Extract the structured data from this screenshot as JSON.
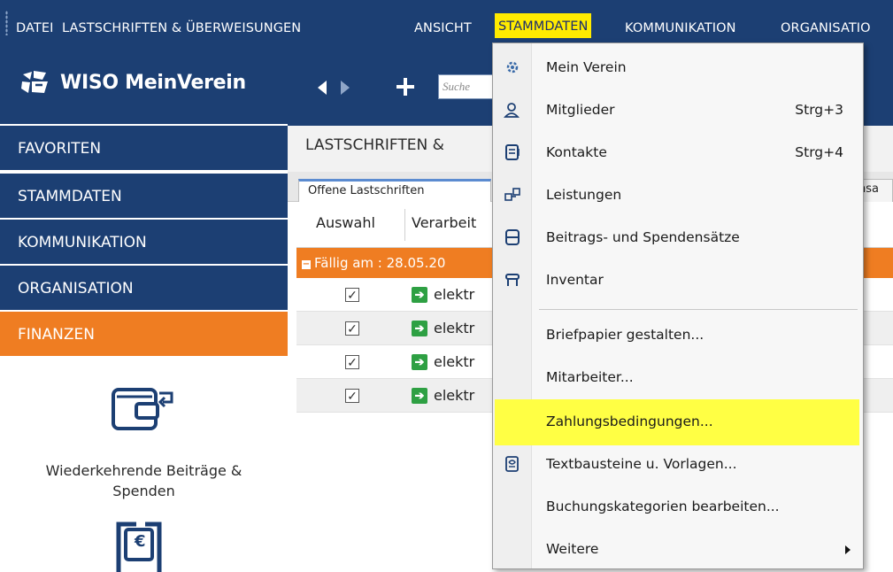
{
  "menubar": {
    "items": [
      "DATEI",
      "LASTSCHRIFTEN & ÜBERWEISUNGEN",
      "ANSICHT",
      "STAMMDATEN",
      "KOMMUNIKATION",
      "ORGANISATIO"
    ]
  },
  "app": {
    "logo_text": "WISO MeinVerein"
  },
  "toolbar": {
    "search_placeholder": "Suche"
  },
  "sidebar": {
    "nav": [
      "FAVORITEN",
      "STAMMDATEN",
      "KOMMUNIKATION",
      "ORGANISATION",
      "FINANZEN"
    ],
    "active": "FINANZEN",
    "tile1_line1": "Wiederkehrende Beiträge &",
    "tile1_line2": "Spenden",
    "tile2_icon_glyph": "€"
  },
  "content": {
    "title": "LASTSCHRIFTEN & ",
    "tabs": [
      "Offene Lastschriften",
      "nsa"
    ],
    "columns": [
      "Auswahl",
      "Verarbeit"
    ],
    "group_label": "Fällig am : 28.05.20",
    "rows": [
      {
        "text": "elektr",
        "checked": true
      },
      {
        "text": "elektr",
        "checked": true
      },
      {
        "text": "elektr",
        "checked": true
      },
      {
        "text": "elektr",
        "checked": true
      }
    ]
  },
  "dropdown": {
    "items": [
      {
        "label": "Mein Verein",
        "shortcut": "",
        "icon": "gear-icon"
      },
      {
        "label": "Mitglieder",
        "shortcut": "Strg+3",
        "icon": "members-icon"
      },
      {
        "label": "Kontakte",
        "shortcut": "Strg+4",
        "icon": "contacts-icon"
      },
      {
        "label": "Leistungen",
        "shortcut": "",
        "icon": "services-icon"
      },
      {
        "label": "Beitrags- und Spendensätze",
        "shortcut": "",
        "icon": "rates-icon"
      },
      {
        "label": "Inventar",
        "shortcut": "",
        "icon": "inventory-icon"
      },
      {
        "label": "Briefpapier gestalten...",
        "shortcut": "",
        "icon": ""
      },
      {
        "label": "Mitarbeiter...",
        "shortcut": "",
        "icon": ""
      },
      {
        "label": "Zahlungsbedingungen...",
        "shortcut": "",
        "icon": ""
      },
      {
        "label": "Textbausteine u. Vorlagen...",
        "shortcut": "",
        "icon": "template-icon"
      },
      {
        "label": "Buchungskategorien bearbeiten...",
        "shortcut": "",
        "icon": ""
      },
      {
        "label": "Weitere",
        "shortcut": "",
        "icon": ""
      }
    ],
    "highlighted": "Zahlungsbedingungen..."
  },
  "colors": {
    "navy": "#1c3f73",
    "orange": "#ef7d22",
    "highlight": "#ffff44",
    "active_menu": "#ffeb00"
  }
}
